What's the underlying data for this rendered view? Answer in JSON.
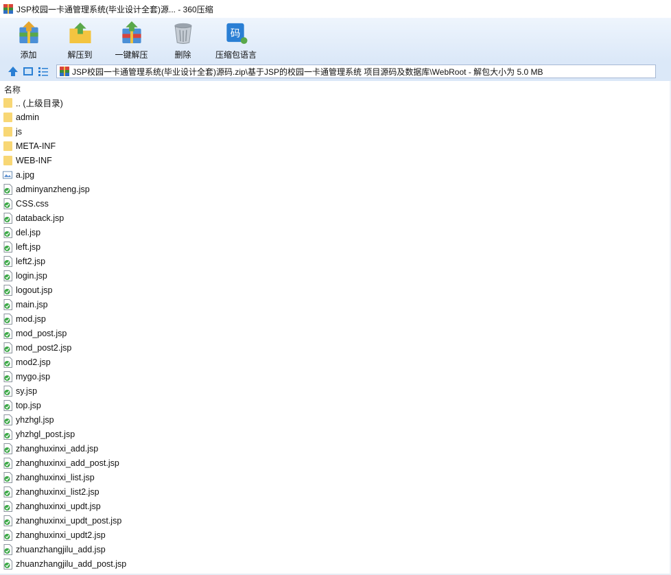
{
  "window": {
    "title": "JSP校园一卡通管理系统(毕业设计全套)源... - 360压缩"
  },
  "toolbar": {
    "buttons": [
      {
        "label": "添加",
        "icon": "add-archive-icon"
      },
      {
        "label": "解压到",
        "icon": "extract-to-icon"
      },
      {
        "label": "一键解压",
        "icon": "one-click-extract-icon"
      },
      {
        "label": "删除",
        "icon": "delete-trash-icon"
      },
      {
        "label": "压缩包语言",
        "icon": "archive-language-icon"
      }
    ]
  },
  "nav": {
    "path": "JSP校园一卡通管理系统(毕业设计全套)源码.zip\\基于JSP的校园一卡通管理系统 项目源码及数据库\\WebRoot - 解包大小为 5.0 MB"
  },
  "list": {
    "header": "名称",
    "items": [
      {
        "name": ".. (上级目录)",
        "type": "folder"
      },
      {
        "name": "admin",
        "type": "folder"
      },
      {
        "name": "js",
        "type": "folder"
      },
      {
        "name": "META-INF",
        "type": "folder"
      },
      {
        "name": "WEB-INF",
        "type": "folder"
      },
      {
        "name": "a.jpg",
        "type": "image"
      },
      {
        "name": "adminyanzheng.jsp",
        "type": "jsp"
      },
      {
        "name": "CSS.css",
        "type": "jsp"
      },
      {
        "name": "databack.jsp",
        "type": "jsp"
      },
      {
        "name": "del.jsp",
        "type": "jsp"
      },
      {
        "name": "left.jsp",
        "type": "jsp"
      },
      {
        "name": "left2.jsp",
        "type": "jsp"
      },
      {
        "name": "login.jsp",
        "type": "jsp"
      },
      {
        "name": "logout.jsp",
        "type": "jsp"
      },
      {
        "name": "main.jsp",
        "type": "jsp"
      },
      {
        "name": "mod.jsp",
        "type": "jsp"
      },
      {
        "name": "mod_post.jsp",
        "type": "jsp"
      },
      {
        "name": "mod_post2.jsp",
        "type": "jsp"
      },
      {
        "name": "mod2.jsp",
        "type": "jsp"
      },
      {
        "name": "mygo.jsp",
        "type": "jsp"
      },
      {
        "name": "sy.jsp",
        "type": "jsp"
      },
      {
        "name": "top.jsp",
        "type": "jsp"
      },
      {
        "name": "yhzhgl.jsp",
        "type": "jsp"
      },
      {
        "name": "yhzhgl_post.jsp",
        "type": "jsp"
      },
      {
        "name": "zhanghuxinxi_add.jsp",
        "type": "jsp"
      },
      {
        "name": "zhanghuxinxi_add_post.jsp",
        "type": "jsp"
      },
      {
        "name": "zhanghuxinxi_list.jsp",
        "type": "jsp"
      },
      {
        "name": "zhanghuxinxi_list2.jsp",
        "type": "jsp"
      },
      {
        "name": "zhanghuxinxi_updt.jsp",
        "type": "jsp"
      },
      {
        "name": "zhanghuxinxi_updt_post.jsp",
        "type": "jsp"
      },
      {
        "name": "zhanghuxinxi_updt2.jsp",
        "type": "jsp"
      },
      {
        "name": "zhuanzhangjilu_add.jsp",
        "type": "jsp"
      },
      {
        "name": "zhuanzhangjilu_add_post.jsp",
        "type": "jsp"
      }
    ]
  },
  "colors": {
    "toolbar_top": "#eef5fd",
    "toolbar_bottom": "#dbe8f8",
    "folder": "#f8d775",
    "accent": "#2a7fd4"
  }
}
